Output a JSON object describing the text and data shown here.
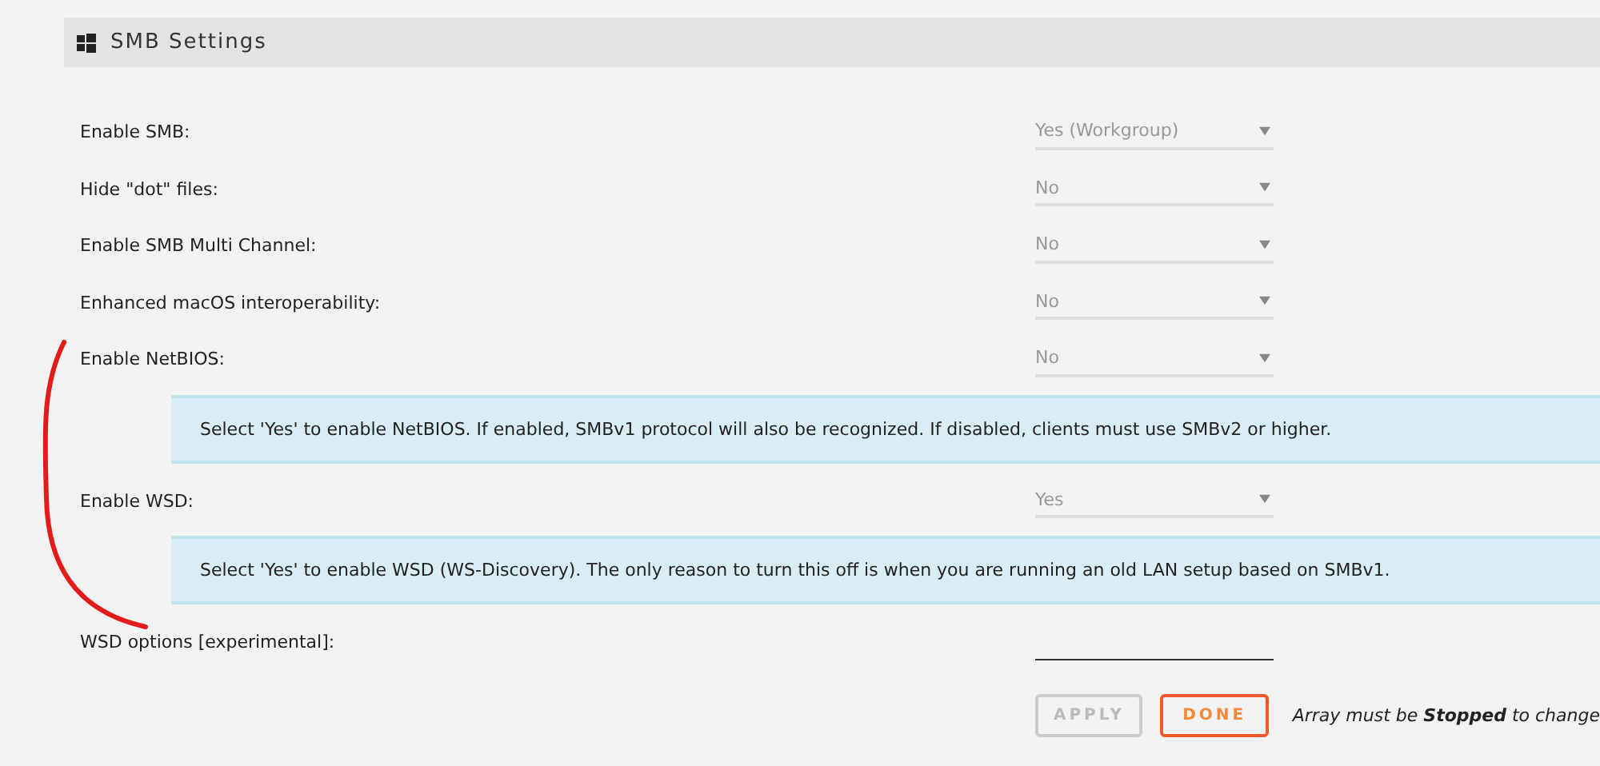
{
  "header": {
    "title": "SMB Settings"
  },
  "rows": [
    {
      "kind": "select",
      "label": "Enable SMB:",
      "value": "Yes (Workgroup)",
      "disabled": true
    },
    {
      "kind": "select",
      "label": "Hide \"dot\" files:",
      "value": "No",
      "disabled": true
    },
    {
      "kind": "select",
      "label": "Enable SMB Multi Channel:",
      "value": "No",
      "disabled": true
    },
    {
      "kind": "select",
      "label": "Enhanced macOS interoperability:",
      "value": "No",
      "disabled": true
    },
    {
      "kind": "select",
      "label": "Enable NetBIOS:",
      "value": "No",
      "disabled": true
    },
    {
      "kind": "help",
      "text": "Select 'Yes' to enable NetBIOS. If enabled, SMBv1 protocol will also be recognized. If disabled, clients must use SMBv2 or higher."
    },
    {
      "kind": "select",
      "label": "Enable WSD:",
      "value": "Yes",
      "disabled": true
    },
    {
      "kind": "help",
      "text": "Select 'Yes' to enable WSD (WS-Discovery). The only reason to turn this off is when you are running an old LAN setup based on SMBv1."
    },
    {
      "kind": "text",
      "label": "WSD options [experimental]:"
    }
  ],
  "buttons": [
    {
      "label": "APPLY",
      "disabled": true
    },
    {
      "label": "DONE",
      "disabled": false
    }
  ],
  "note": "Array must be **Stopped** to change"
}
